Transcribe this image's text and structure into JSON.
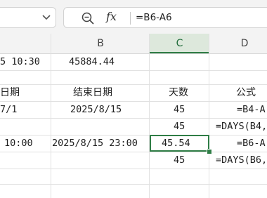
{
  "formula_bar": {
    "name_box_value": "",
    "fx_label": "fx",
    "formula": "=B6-A6"
  },
  "columns": [
    {
      "id": "B",
      "label": "B"
    },
    {
      "id": "C",
      "label": "C"
    },
    {
      "id": "D",
      "label": "D"
    }
  ],
  "selected_column": "C",
  "rows": [
    {
      "a": "5 10:30",
      "b": "45884.44",
      "c": "",
      "d": ""
    },
    {
      "a": "",
      "b": "",
      "c": "",
      "d": ""
    },
    {
      "a": "日期",
      "b": "结束日期",
      "c": "天数",
      "d": "公式"
    },
    {
      "a": "7/1",
      "b": "2025/8/15",
      "c": "45",
      "d": "=B4-A"
    },
    {
      "a": "",
      "b": "",
      "c": "45",
      "d": "=DAYS(B4,"
    },
    {
      "a": "10:00",
      "b": "2025/8/15 23:00",
      "c": "45.54",
      "d": "=B6-A"
    },
    {
      "a": "",
      "b": "",
      "c": "45",
      "d": "=DAYS(B6,"
    },
    {
      "a": "",
      "b": "",
      "c": "",
      "d": ""
    },
    {
      "a": "",
      "b": "",
      "c": "",
      "d": ""
    }
  ],
  "active_cell": "C6",
  "colors": {
    "accent": "#2f7d46",
    "header_bg": "#f3f3f3",
    "selected_header_bg": "#dde8dc"
  }
}
